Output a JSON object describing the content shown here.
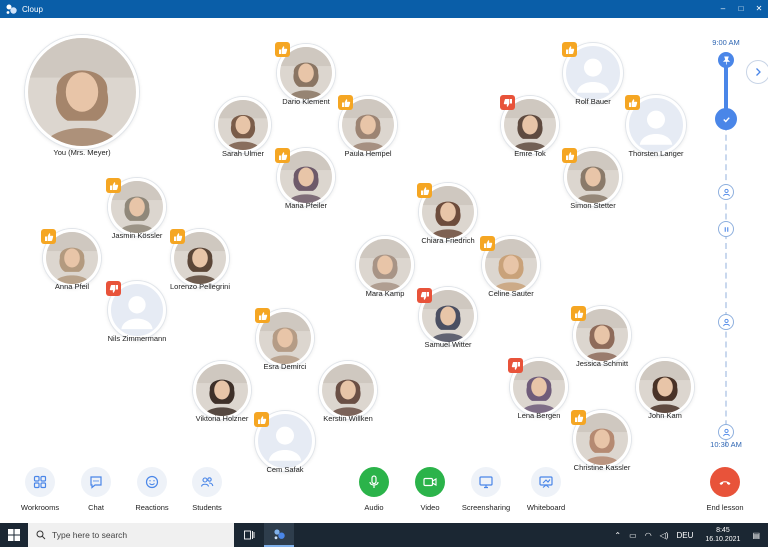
{
  "window": {
    "title": "Cloup",
    "minimize_glyph": "–",
    "maximize_glyph": "□",
    "close_glyph": "✕"
  },
  "participants": {
    "teacher": {
      "name": "You (Mrs. Meyer)",
      "kind": "photo",
      "tone": "#a5856b"
    },
    "dario": {
      "name": "Dario Klement",
      "reaction": "thumbs-up",
      "kind": "photo",
      "tone": "#8a7563"
    },
    "sarah": {
      "name": "Sarah Ulmer",
      "reaction": "",
      "kind": "photo",
      "tone": "#7a5c49"
    },
    "paula": {
      "name": "Paula Hempel",
      "reaction": "thumbs-up",
      "kind": "photo",
      "tone": "#9c8473"
    },
    "maria": {
      "name": "Maria Pfeiler",
      "reaction": "thumbs-up",
      "kind": "photo",
      "tone": "#6e5a6a"
    },
    "rolf": {
      "name": "Rolf Bauer",
      "reaction": "thumbs-up",
      "kind": "placeholder"
    },
    "emre": {
      "name": "Emre Tok",
      "reaction": "thumbs-down",
      "kind": "photo",
      "tone": "#5f4b40"
    },
    "thorsten": {
      "name": "Thorsten Langer",
      "reaction": "thumbs-up",
      "kind": "placeholder"
    },
    "simon": {
      "name": "Simon Stetter",
      "reaction": "thumbs-up",
      "kind": "photo",
      "tone": "#8a7a6a"
    },
    "jasmin": {
      "name": "Jasmin Kössler",
      "reaction": "thumbs-up",
      "kind": "photo",
      "tone": "#90887a"
    },
    "anna": {
      "name": "Anna Pfeil",
      "reaction": "thumbs-up",
      "kind": "photo",
      "tone": "#b39a7f"
    },
    "lorenzo": {
      "name": "Lorenzo Pellegrini",
      "reaction": "thumbs-up",
      "kind": "photo",
      "tone": "#5b4638"
    },
    "nils": {
      "name": "Nils Zimmermann",
      "reaction": "thumbs-down",
      "kind": "placeholder"
    },
    "chiara": {
      "name": "Chiara Friedrich",
      "reaction": "thumbs-up",
      "kind": "photo",
      "tone": "#6d4c3c"
    },
    "mara": {
      "name": "Mara Kamp",
      "reaction": "",
      "kind": "photo",
      "tone": "#a89486"
    },
    "celine": {
      "name": "Celine Sauter",
      "reaction": "thumbs-up",
      "kind": "photo",
      "tone": "#c9a27a"
    },
    "samuel": {
      "name": "Samuel Witter",
      "reaction": "thumbs-down",
      "kind": "photo",
      "tone": "#4b4f62"
    },
    "esra": {
      "name": "Esra Demirci",
      "reaction": "thumbs-up",
      "kind": "photo",
      "tone": "#b59c86"
    },
    "viktoria": {
      "name": "Viktoria Holzner",
      "reaction": "",
      "kind": "photo",
      "tone": "#3e3029"
    },
    "kerstin": {
      "name": "Kerstin Willken",
      "reaction": "",
      "kind": "photo",
      "tone": "#6a4f45"
    },
    "cem": {
      "name": "Cem Safak",
      "reaction": "thumbs-up",
      "kind": "placeholder"
    },
    "jessica": {
      "name": "Jessica Schmitt",
      "reaction": "thumbs-up",
      "kind": "photo",
      "tone": "#8e6b5a"
    },
    "lena": {
      "name": "Lena Bergen",
      "reaction": "thumbs-down",
      "kind": "photo",
      "tone": "#6f5c7a"
    },
    "john": {
      "name": "John Kam",
      "reaction": "",
      "kind": "photo",
      "tone": "#4a3328"
    },
    "christine": {
      "name": "Christine Kassler",
      "reaction": "thumbs-up",
      "kind": "photo",
      "tone": "#b58a72"
    }
  },
  "timeline": {
    "start": "9:00 AM",
    "end": "10:30 AM",
    "progress": 0.15
  },
  "toolbar": {
    "workrooms": "Workrooms",
    "chat": "Chat",
    "reactions": "Reactions",
    "students": "Students",
    "audio": "Audio",
    "video": "Video",
    "screensharing": "Screensharing",
    "whiteboard": "Whiteboard",
    "end_lesson": "End lesson"
  },
  "taskbar": {
    "search_placeholder": "Type here to search",
    "language": "DEU",
    "time": "8:45",
    "date": "16.10.2021"
  },
  "colors": {
    "brand": "#0a5ea8",
    "accent": "#4a86e8",
    "thumbs_up": "#f5a623",
    "thumbs_down": "#e8533a",
    "mic_video": "#2bb34a",
    "end": "#e8533a"
  }
}
